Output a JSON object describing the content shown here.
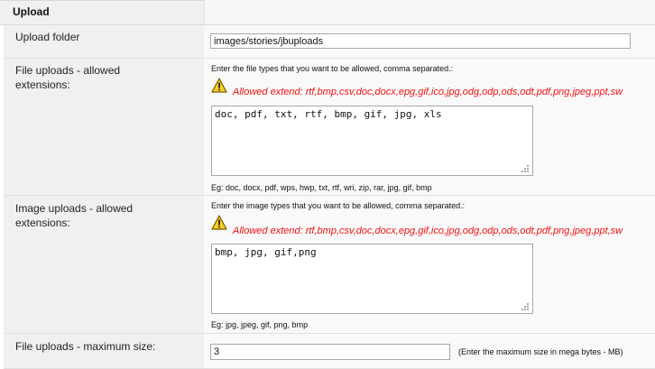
{
  "section": {
    "title": "Upload"
  },
  "upload_folder": {
    "label": "Upload folder",
    "value": "images/stories/jbuploads"
  },
  "file_extensions": {
    "label_line1": "File uploads - allowed",
    "label_line2": "extensions:",
    "instruction": "Enter the file types that you want to be allowed, comma separated.:",
    "allowed_extend": "Allowed extend: rtf,bmp,csv,doc,docx,epg,gif,ico,jpg,odg,odp,ods,odt,pdf,png,jpeg,ppt,sw",
    "value": "doc, pdf, txt, rtf, bmp, gif, jpg, xls",
    "example": "Eg: doc, docx, pdf, wps, hwp, txt, rtf, wri, zip, rar, jpg, gif, bmp"
  },
  "image_extensions": {
    "label_line1": "Image uploads - allowed",
    "label_line2": "extensions:",
    "instruction": "Enter the image types that you want to be allowed, comma separated.:",
    "allowed_extend": "Allowed extend: rtf,bmp,csv,doc,docx,epg,gif,ico,jpg,odg,odp,ods,odt,pdf,png,jpeg,ppt,sw",
    "value": "bmp, jpg, gif,png",
    "example": "Eg: jpg, jpeg, gif, png, bmp"
  },
  "max_size": {
    "label": "File uploads - maximum size:",
    "value": "3",
    "hint": "(Enter the maximum size in mega bytes - MB)"
  },
  "icons": {
    "warning": "warning-triangle-icon",
    "resize": "resize-grip-icon"
  },
  "colors": {
    "warning": "#ee1111",
    "label_bg": "#f0f0f0",
    "value_bg": "#f9f9f9"
  }
}
